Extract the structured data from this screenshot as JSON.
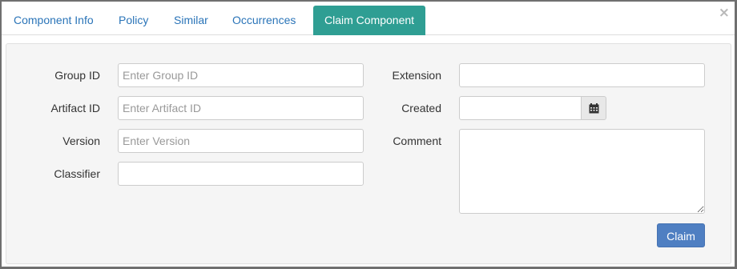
{
  "dialog": {
    "close_symbol": "×"
  },
  "tabs": [
    {
      "label": "Component Info"
    },
    {
      "label": "Policy"
    },
    {
      "label": "Similar"
    },
    {
      "label": "Occurrences"
    },
    {
      "label": "Claim Component",
      "active": true
    }
  ],
  "form": {
    "group_id": {
      "label": "Group ID",
      "placeholder": "Enter Group ID",
      "value": ""
    },
    "artifact_id": {
      "label": "Artifact ID",
      "placeholder": "Enter Artifact ID",
      "value": ""
    },
    "version": {
      "label": "Version",
      "placeholder": "Enter Version",
      "value": ""
    },
    "classifier": {
      "label": "Classifier",
      "placeholder": "",
      "value": ""
    },
    "extension": {
      "label": "Extension",
      "placeholder": "",
      "value": ""
    },
    "created": {
      "label": "Created",
      "value": "",
      "icon": "calendar-icon"
    },
    "comment": {
      "label": "Comment",
      "value": ""
    },
    "claim_button": "Claim"
  },
  "colors": {
    "active_tab": "#2f9e93",
    "link": "#2a74b8",
    "primary_button": "#4f7fc2"
  }
}
